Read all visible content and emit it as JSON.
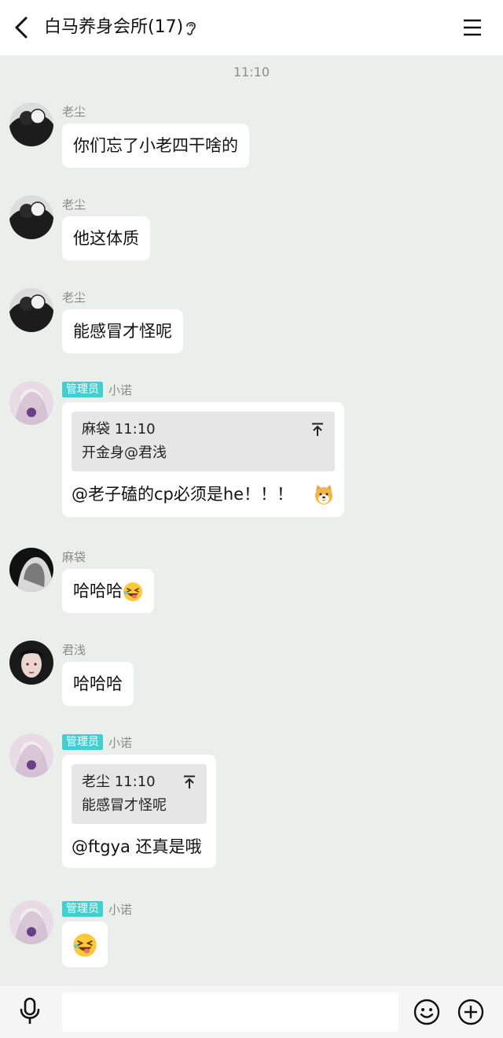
{
  "header": {
    "title": "白马养身会所(17)",
    "back_icon": "chevron-left-icon",
    "ear_icon": "ear-icon",
    "menu_icon": "hamburger-menu-icon"
  },
  "timestamp": "11:10",
  "messages": [
    {
      "sender": "老尘",
      "text": "你们忘了小老四干啥的"
    },
    {
      "sender": "老尘",
      "text": "他这体质"
    },
    {
      "sender": "老尘",
      "text": "能感冒才怪呢"
    },
    {
      "badge": "管理员",
      "sender": "小诺",
      "quote_head": "麻袋 11:10",
      "quote_text": "开金身@君浅",
      "text": "@老子磕的cp必须是he！！！",
      "emoji": "shiba-face-emoji"
    },
    {
      "sender": "麻袋",
      "text": "哈哈哈",
      "emoji": "laughing-tongue-emoji"
    },
    {
      "sender": "君浅",
      "text": "哈哈哈"
    },
    {
      "badge": "管理员",
      "sender": "小诺",
      "quote_head": "老尘 11:10",
      "quote_text": "能感冒才怪呢",
      "text": "@ftgya 还真是哦"
    },
    {
      "badge": "管理员",
      "sender": "小诺",
      "emoji": "laughing-tongue-emoji"
    }
  ],
  "footer": {
    "mic_icon": "microphone-icon",
    "input_value": "",
    "emoji_icon": "smile-icon",
    "plus_icon": "plus-circle-icon"
  },
  "colors": {
    "background": "#ebefeb",
    "badge": "#3fd0cf",
    "bubble": "#ffffff",
    "quote": "#e6e6e6"
  }
}
